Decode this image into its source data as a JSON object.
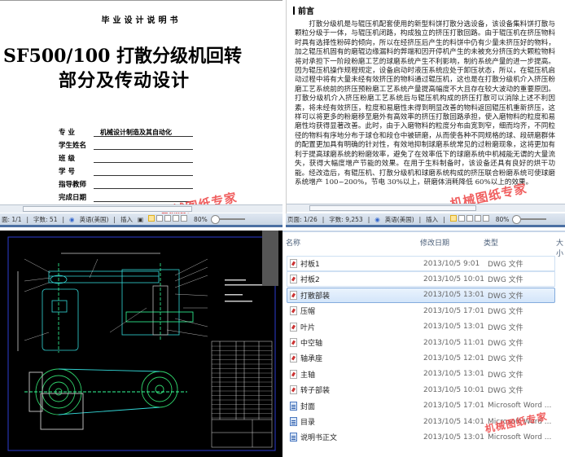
{
  "watermark": "机械图纸专家",
  "cover_doc": {
    "header": "毕业设计说明书",
    "title_line1": "SF500/100 打散分级机回转",
    "title_line2": "部分及传动设计",
    "fields": [
      {
        "label": "专    业",
        "value": "机械设计制造及其自动化"
      },
      {
        "label": "学生姓名",
        "value": ""
      },
      {
        "label": "班    级",
        "value": ""
      },
      {
        "label": "学    号",
        "value": ""
      },
      {
        "label": "指导教师",
        "value": ""
      },
      {
        "label": "完成日期",
        "value": ""
      }
    ],
    "status": {
      "page": "面: 1/1",
      "words": "字数: 51",
      "language": "英语(美国)",
      "mode": "插入",
      "zoom": "80%"
    }
  },
  "preface_doc": {
    "heading": "前言",
    "body": "打散分级机是与辊压机配套使用的新型料饼打散分选设备，该设备集料饼打散与颗粒分级于一体，与辊压机闭路，构成独立的挤压打散回路。由于辊压机在挤压物料时具有选择性粉碎的倾向，所以在经挤压后产生的料饼中仍有少量未挤压好的物料，加之辊压机固有的磨辊边缘漏料的弊端和因开停机产生的未被充分挤压的大颗粒物料将对承担下一阶段粉磨工艺的球磨系统产生不利影响，制约系统产量的进一步提高。因为辊压机操作规程规定，设备启动时液压系统应处于卸压状态，所以，在辊压机启动过程中将有大量未经有效挤压的物料通过辊压机，这也是在打散分级机介入挤压粉磨工艺系统前的挤压预粉磨工艺系统产量提高幅度不大且存在较大波动的重要原因。打散分级机介入挤压粉磨工艺系统后与辊压机构成的挤压打散可以消除上述不利因素，将未经有效挤压，粒度和易磨性未得到明显改善的物料返回辊压机重新挤压，这样可以将更多的粉磨移至磨外有高效率的挤压打散回路承担，使入磨物料的粒度和易磨性均获得显著改善。此时，由于入磨物料的粒度分布由宽到窄，细而均齐，不同粒径的物料有序地分布于球仓和段仓中被研磨，从而使各种不同规格的球、段研磨群体的配置更加具有明确的针对性，有效地抑制球磨系统常见的过粉磨现象，这将更加有利于提高球磨系统的粉磨效率，避免了在效率低下的球磨系统中机械能无谓的大量流失，获得大幅度增产节能的效果。在用于生料制备时，该设备还具有良好的烘干功能。经改造后，有辊压机、打散分级机和球磨系统构成的挤压联合粉磨系统可使球磨系统增产 100~200%，节电 30%以上，研磨体消耗降低 60%以上的效果。",
    "status": {
      "page": "页面: 1/26",
      "words": "字数: 9,253",
      "language": "英语(美国)",
      "mode": "插入",
      "zoom": "80%"
    }
  },
  "explorer": {
    "columns": [
      "名称",
      "修改日期",
      "类型",
      "大小"
    ],
    "files": [
      {
        "name": "衬板1",
        "date": "2013/10/5 9:01",
        "type": "DWG 文件",
        "icon": "dwg"
      },
      {
        "name": "衬板2",
        "date": "2013/10/5 10:01",
        "type": "DWG 文件",
        "icon": "dwg"
      },
      {
        "name": "打散部装",
        "date": "2013/10/5 13:01",
        "type": "DWG 文件",
        "icon": "dwg",
        "selected": true
      },
      {
        "name": "压帽",
        "date": "2013/10/5 17:01",
        "type": "DWG 文件",
        "icon": "dwg"
      },
      {
        "name": "叶片",
        "date": "2013/10/5 13:01",
        "type": "DWG 文件",
        "icon": "dwg"
      },
      {
        "name": "中空轴",
        "date": "2013/10/5 11:01",
        "type": "DWG 文件",
        "icon": "dwg"
      },
      {
        "name": "轴承座",
        "date": "2013/10/5 12:01",
        "type": "DWG 文件",
        "icon": "dwg"
      },
      {
        "name": "主轴",
        "date": "2013/10/5 13:01",
        "type": "DWG 文件",
        "icon": "dwg"
      },
      {
        "name": "转子部装",
        "date": "2013/10/5 10:01",
        "type": "DWG 文件",
        "icon": "dwg"
      },
      {
        "name": "封面",
        "date": "2013/10/5 17:01",
        "type": "Microsoft Word ...",
        "icon": "word"
      },
      {
        "name": "目录",
        "date": "2013/10/5 14:01",
        "type": "Microsoft Word ...",
        "icon": "word"
      },
      {
        "name": "说明书正文",
        "date": "2013/10/5 13:01",
        "type": "Microsoft Word ...",
        "icon": "word"
      }
    ]
  },
  "colors": {
    "cad_background": "#000000",
    "cad_cyan": "#33d6d6",
    "cad_green": "#2fd06a",
    "selection": "#d3e5fa",
    "watermark": "#e44444"
  }
}
